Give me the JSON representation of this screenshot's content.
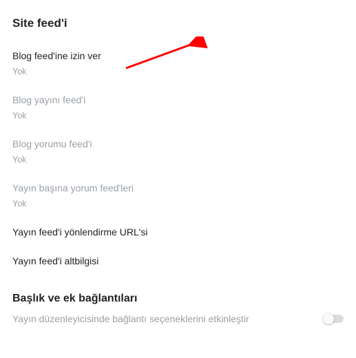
{
  "section_title": "Site feed'i",
  "settings": [
    {
      "label": "Blog feed'ine izin ver",
      "value": "Yok",
      "disabled": false
    },
    {
      "label": "Blog yayını feed'i",
      "value": "Yok",
      "disabled": true
    },
    {
      "label": "Blog yorumu feed'i",
      "value": "Yok",
      "disabled": true
    },
    {
      "label": "Yayın başına yorum feed'leri",
      "value": "Yok",
      "disabled": true
    },
    {
      "label": "Yayın feed'i yönlendirme URL'si",
      "value": null,
      "disabled": false
    },
    {
      "label": "Yayın feed'i altbilgisi",
      "value": null,
      "disabled": false
    }
  ],
  "section2_title": "Başlık ve ek bağlantıları",
  "toggle": {
    "label": "Yayın düzenleyicisinde bağlantı seçeneklerini etkinleştir",
    "on": false
  },
  "annotation": {
    "arrow_color": "#ff0000"
  }
}
